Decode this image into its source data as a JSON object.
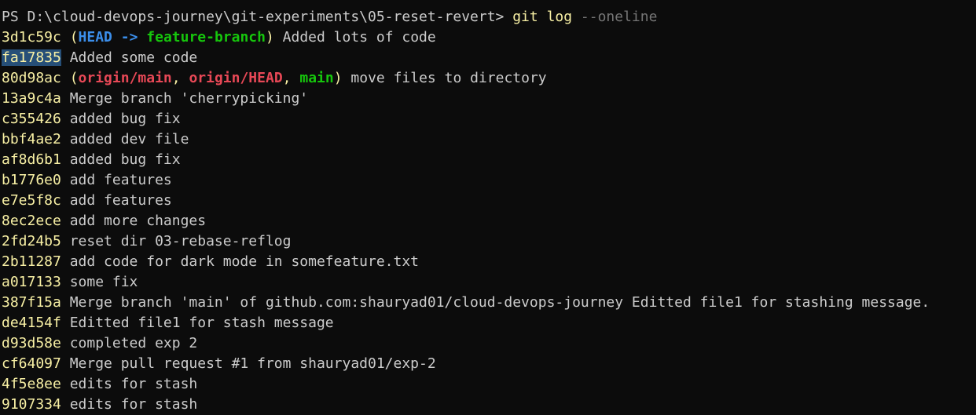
{
  "prompt": {
    "path": "PS D:\\cloud-devops-journey\\git-experiments\\05-reset-revert> ",
    "command": "git log",
    "args": " --oneline"
  },
  "commits": [
    {
      "hash": "3d1c59c",
      "message": " Added lots of code"
    },
    {
      "hash": "fa17835",
      "message": " Added some code"
    },
    {
      "hash": "80d98ac",
      "message": " move files to directory"
    },
    {
      "hash": "13a9c4a",
      "message": " Merge branch 'cherrypicking'"
    },
    {
      "hash": "c355426",
      "message": " added bug fix"
    },
    {
      "hash": "bbf4ae2",
      "message": " added dev file"
    },
    {
      "hash": "af8d6b1",
      "message": " added bug fix"
    },
    {
      "hash": "b1776e0",
      "message": " add features"
    },
    {
      "hash": "e7e5f8c",
      "message": " add features"
    },
    {
      "hash": "8ec2ece",
      "message": " add more changes"
    },
    {
      "hash": "2fd24b5",
      "message": " reset dir 03-rebase-reflog"
    },
    {
      "hash": "2b11287",
      "message": " add code for dark mode in somefeature.txt"
    },
    {
      "hash": "a017133",
      "message": " some fix"
    },
    {
      "hash": "387f15a",
      "message": " Merge branch 'main' of github.com:shauryad01/cloud-devops-journey Editted file1 for stashing message."
    },
    {
      "hash": "de4154f",
      "message": " Editted file1 for stash message"
    },
    {
      "hash": "d93d58e",
      "message": " completed exp 2"
    },
    {
      "hash": "cf64097",
      "message": " Merge pull request #1 from shauryad01/exp-2"
    },
    {
      "hash": "4f5e8ee",
      "message": " edits for stash"
    },
    {
      "hash": "9107334",
      "message": " edits for stash"
    }
  ],
  "refs": {
    "head_open": " (",
    "head": "HEAD",
    "arrow": " -> ",
    "feature_branch": "feature-branch",
    "head_close": ")",
    "remote_open": " (",
    "origin_main": "origin/main",
    "sep1": ", ",
    "origin_head": "origin/HEAD",
    "sep2": ", ",
    "main": "main",
    "remote_close": ")"
  },
  "colors": {
    "background": "#0c0c0c",
    "text": "#cccccc",
    "hash": "#f9f1a5",
    "head": "#3b8eea",
    "local_branch": "#16c60c",
    "remote_branch": "#e74856",
    "selection": "#264f78"
  }
}
